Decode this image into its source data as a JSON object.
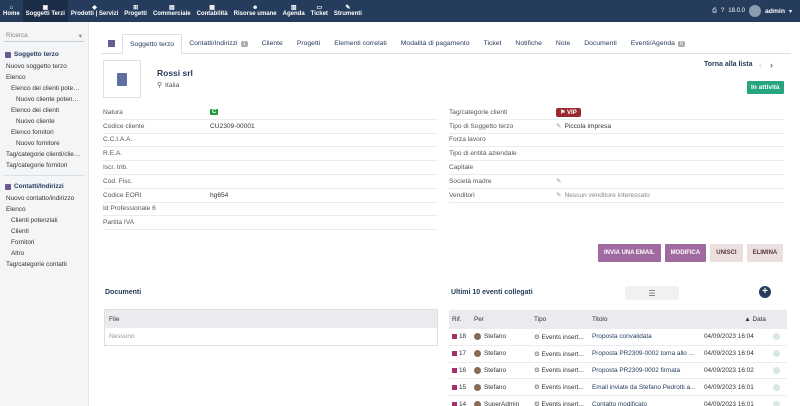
{
  "topbar": {
    "menu": [
      {
        "label": "Home",
        "icon": "home-icon"
      },
      {
        "label": "Soggetti Terzi",
        "icon": "building-icon",
        "active": true
      },
      {
        "label": "Prodotti | Servizi",
        "icon": "cube-icon"
      },
      {
        "label": "Progetti",
        "icon": "sitemap-icon"
      },
      {
        "label": "Commerciale",
        "icon": "suitcase-icon"
      },
      {
        "label": "Contabilità",
        "icon": "calculator-icon"
      },
      {
        "label": "Risorse umane",
        "icon": "user-tie-icon"
      },
      {
        "label": "Agenda",
        "icon": "calendar-icon"
      },
      {
        "label": "Ticket",
        "icon": "ticket-icon"
      },
      {
        "label": "Strumenti",
        "icon": "wrench-icon"
      }
    ],
    "version": "18.0.0",
    "user": "admin"
  },
  "sidebar": {
    "search_placeholder": "Ricerca",
    "section1": "Soggetto terzo",
    "links1": [
      {
        "label": "Nuovo soggetto terzo",
        "level": 1
      },
      {
        "label": "Elenco",
        "level": 1
      },
      {
        "label": "Elenco dei clienti poten...",
        "level": 2
      },
      {
        "label": "Nuovo cliente potenzi...",
        "level": 3
      },
      {
        "label": "Elenco dei clienti",
        "level": 2
      },
      {
        "label": "Nuovo cliente",
        "level": 3
      },
      {
        "label": "Elenco fornitori",
        "level": 2
      },
      {
        "label": "Nuovo fornitore",
        "level": 3
      },
      {
        "label": "Tag/categorie clienti/clien...",
        "level": 1
      },
      {
        "label": "Tag/categorie fornitori",
        "level": 1
      }
    ],
    "section2": "Contatti/Indirizzi",
    "links2": [
      {
        "label": "Nuovo contatto/indirizzo",
        "level": 1
      },
      {
        "label": "Elenco",
        "level": 1
      },
      {
        "label": "Clienti potenziali",
        "level": 2
      },
      {
        "label": "Clienti",
        "level": 2
      },
      {
        "label": "Fornitori",
        "level": 2
      },
      {
        "label": "Altro",
        "level": 2
      },
      {
        "label": "Tag/categorie contatti",
        "level": 1
      }
    ]
  },
  "tabs": [
    {
      "label": "Soggetto terzo",
      "active": true
    },
    {
      "label": "Contatti/Indirizzi",
      "badge": "1"
    },
    {
      "label": "Cliente"
    },
    {
      "label": "Progetti"
    },
    {
      "label": "Elementi correlati"
    },
    {
      "label": "Modalità di pagamento"
    },
    {
      "label": "Ticket"
    },
    {
      "label": "Notifiche"
    },
    {
      "label": "Note"
    },
    {
      "label": "Documenti"
    },
    {
      "label": "Eventi/Agenda",
      "badge": "6"
    }
  ],
  "company": {
    "name": "Rossi srl",
    "country": "Italia",
    "back_label": "Torna alla lista",
    "prev": "‹",
    "next": "›",
    "status": "In attività"
  },
  "left_fields": [
    {
      "label": "Natura",
      "value": "C",
      "badge": true
    },
    {
      "label": "Codice cliente",
      "value": "CU2309-00001"
    },
    {
      "label": "C.C.I.A.A.",
      "value": ""
    },
    {
      "label": "R.E.A.",
      "value": ""
    },
    {
      "label": "Iscr. trib.",
      "value": ""
    },
    {
      "label": "Cod. Fisc.",
      "value": ""
    },
    {
      "label": "Codice EORI",
      "value": "hg654"
    },
    {
      "label": "Id Professionale 6",
      "value": ""
    },
    {
      "label": "Partita IVA",
      "value": ""
    }
  ],
  "right_fields": [
    {
      "label": "Tag/categorie clienti",
      "value": "VIP",
      "vip": true
    },
    {
      "label": "Tipo di Soggetto terzo",
      "value": "Piccola impresa",
      "pencil": true
    },
    {
      "label": "Forza lavoro",
      "value": ""
    },
    {
      "label": "Tipo di entità aziendale",
      "value": ""
    },
    {
      "label": "Capitale",
      "value": ""
    },
    {
      "label": "Società madre",
      "value": "",
      "pencil": true
    },
    {
      "label": "Venditori",
      "value": "Nessun venditore interessato",
      "pencil": true,
      "muted": true
    }
  ],
  "actions": {
    "email": "INVIA UNA EMAIL",
    "modify": "MODIFICA",
    "merge": "UNISCI",
    "delete": "ELIMINA"
  },
  "documents": {
    "title": "Documenti",
    "col_file": "File",
    "empty": "Nessuno"
  },
  "events": {
    "title": "Ultimi 10 eventi collegati",
    "add": "+",
    "headers": {
      "rif": "Rif.",
      "per": "Per",
      "tipo": "Tipo",
      "titolo": "Titolo",
      "data": "▲ Data"
    },
    "rows": [
      {
        "rif": "18",
        "per": "Stefano",
        "tipo": "Events insert...",
        "titolo": "Proposta convalidata",
        "data": "04/09/2023 16:04"
      },
      {
        "rif": "17",
        "per": "Stefano",
        "tipo": "Events insert...",
        "titolo": "Proposta PR2309-0002 torna allo ...",
        "data": "04/09/2023 16:04"
      },
      {
        "rif": "16",
        "per": "Stefano",
        "tipo": "Events insert...",
        "titolo": "Proposta PR2309-0002 firmata",
        "data": "04/09/2023 16:02"
      },
      {
        "rif": "15",
        "per": "Stefano",
        "tipo": "Events insert...",
        "titolo": "Email inviate da Stefano Pedrotti a...",
        "data": "04/09/2023 16:01"
      },
      {
        "rif": "14",
        "per": "SuperAdmin",
        "tipo": "Events insert...",
        "titolo": "Contatto modificato",
        "data": "04/09/2023 16:01"
      }
    ]
  }
}
